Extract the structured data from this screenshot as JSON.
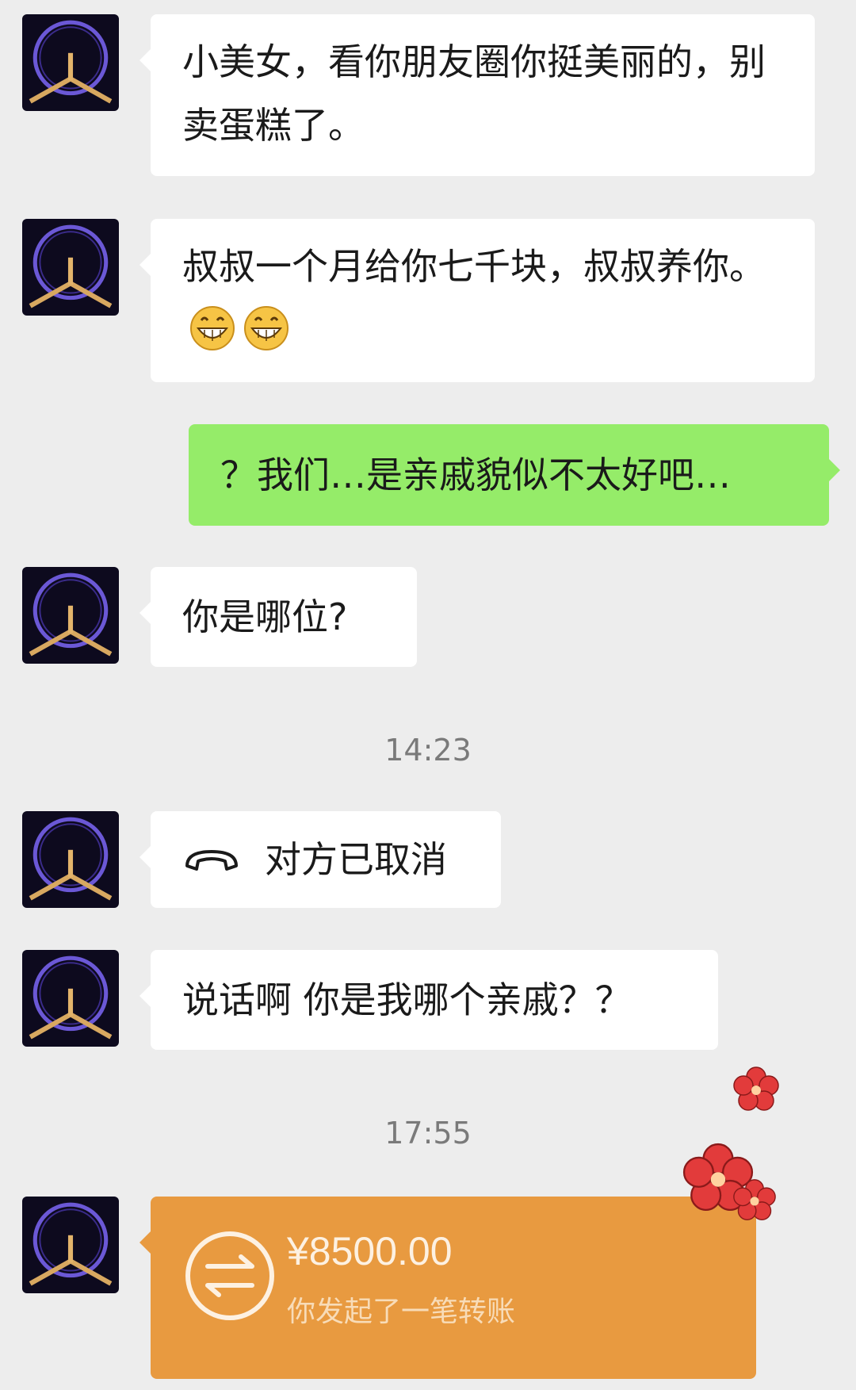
{
  "messages": [
    {
      "side": "left",
      "text": "小美女，看你朋友圈你挺美丽的，别卖蛋糕了。"
    },
    {
      "side": "left",
      "text": "叔叔一个月给你七千块，叔叔养你。",
      "emoji_count": 2
    },
    {
      "side": "right",
      "text": "？我们…是亲戚貌似不太好吧…"
    },
    {
      "side": "left",
      "text": "你是哪位?"
    },
    {
      "type": "time",
      "text": "14:23"
    },
    {
      "side": "left",
      "type": "call",
      "text": "对方已取消"
    },
    {
      "side": "left",
      "text": "说话啊 你是我哪个亲戚？？"
    },
    {
      "type": "time",
      "text": "17:55"
    },
    {
      "side": "left",
      "type": "transfer",
      "amount": "¥8500.00",
      "desc": "你发起了一笔转账"
    }
  ],
  "icons": {
    "avatar": "avatar-ring-sculpture-icon",
    "emoji": "grin-emoji-icon",
    "call": "phone-hangup-icon",
    "transfer": "transfer-arrows-icon",
    "decoration": "plum-blossom-icon"
  },
  "colors": {
    "background": "#ededed",
    "incoming_bubble": "#ffffff",
    "outgoing_bubble": "#95ec69",
    "transfer_bubble": "#e89a40",
    "time_text": "#7a7a7a"
  }
}
